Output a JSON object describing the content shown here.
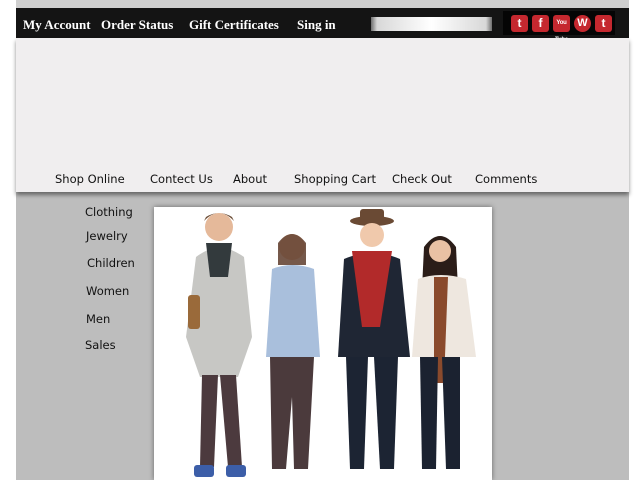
{
  "topbar": {
    "links": [
      "My Account",
      "Order Status",
      "Gift Certificates",
      "Sing in"
    ],
    "search": {
      "value": "",
      "placeholder": ""
    },
    "social": [
      {
        "icon": "twitter-icon",
        "glyph": "t"
      },
      {
        "icon": "facebook-icon",
        "glyph": "f"
      },
      {
        "icon": "youtube-icon",
        "glyph": "You Tube"
      },
      {
        "icon": "wordpress-icon",
        "glyph": "W"
      },
      {
        "icon": "tumblr-icon",
        "glyph": "t"
      }
    ],
    "colors": {
      "bar": "#141414",
      "social_accent": "#c5282f"
    }
  },
  "nav": {
    "items": [
      "Shop Online",
      "Contect Us",
      "About",
      "Shopping Cart",
      "Check Out",
      "Comments"
    ]
  },
  "sidebar": {
    "items": [
      "Clothing",
      "Jewelry",
      "Children",
      "Women",
      "Men",
      "Sales"
    ]
  },
  "hero": {
    "icon": "fashion-group-photo"
  },
  "colors": {
    "page_background": "#bdbdbd",
    "header_panel": "#f0eeef"
  }
}
